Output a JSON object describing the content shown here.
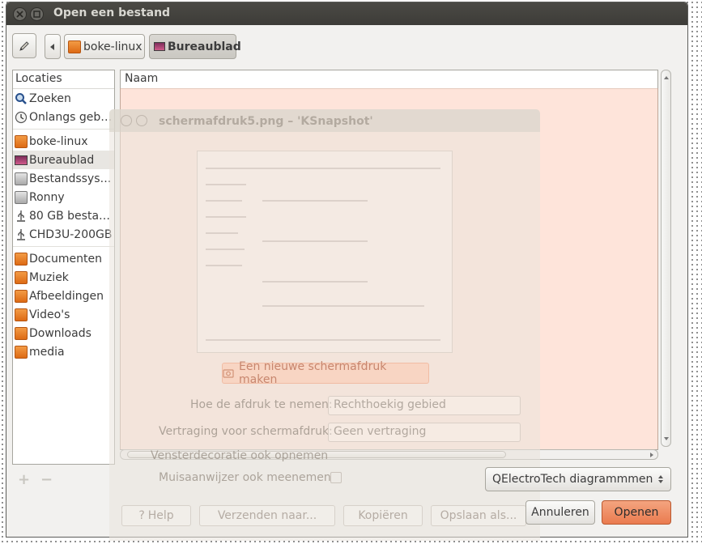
{
  "window": {
    "title": "Open een bestand"
  },
  "toolbar": {
    "crumbs": [
      "boke-linux",
      "Bureaublad"
    ]
  },
  "sidebar": {
    "header": "Locaties",
    "items": [
      {
        "label": "Zoeken",
        "icon": "search-icon"
      },
      {
        "label": "Onlangs geb…",
        "icon": "recent-icon"
      },
      {
        "label": "boke-linux",
        "icon": "home-folder-icon"
      },
      {
        "label": "Bureaublad",
        "icon": "desktop-icon"
      },
      {
        "label": "Bestandssys…",
        "icon": "filesystem-icon"
      },
      {
        "label": "Ronny",
        "icon": "drive-icon"
      },
      {
        "label": "80 GB besta…",
        "icon": "usb-drive-icon"
      },
      {
        "label": "CHD3U-200GB",
        "icon": "usb-drive-icon"
      },
      {
        "label": "Documenten",
        "icon": "folder-icon"
      },
      {
        "label": "Muziek",
        "icon": "music-folder-icon"
      },
      {
        "label": "Afbeeldingen",
        "icon": "pictures-folder-icon"
      },
      {
        "label": "Video's",
        "icon": "videos-folder-icon"
      },
      {
        "label": "Downloads",
        "icon": "folder-icon"
      },
      {
        "label": "media",
        "icon": "folder-icon"
      }
    ]
  },
  "filelist": {
    "column_header": "Naam"
  },
  "filter": {
    "selected": "QElectroTech diagrammmen"
  },
  "buttons": {
    "cancel": "Annuleren",
    "open": "Openen"
  },
  "overlay": {
    "title": "schermafdruk5.png – 'KSnapshot'",
    "new_snapshot": "Een nieuwe schermafdruk maken",
    "mode_label": "Hoe de afdruk te nemen:",
    "mode_value": "Rechthoekig gebied",
    "delay_label": "Vertraging voor schermafdruk:",
    "delay_value": "Geen vertraging",
    "decoration_label": "Vensterdecoratie ook opnemen",
    "pointer_label": "Muisaanwijzer ook meenemen",
    "help": "Help",
    "send": "Verzenden naar...",
    "copy": "Kopiëren",
    "save": "Opslaan als..."
  },
  "colors": {
    "accent": "#ea7b4f",
    "titlebar": "#3d3c38",
    "selection": "#e8e6e2"
  }
}
